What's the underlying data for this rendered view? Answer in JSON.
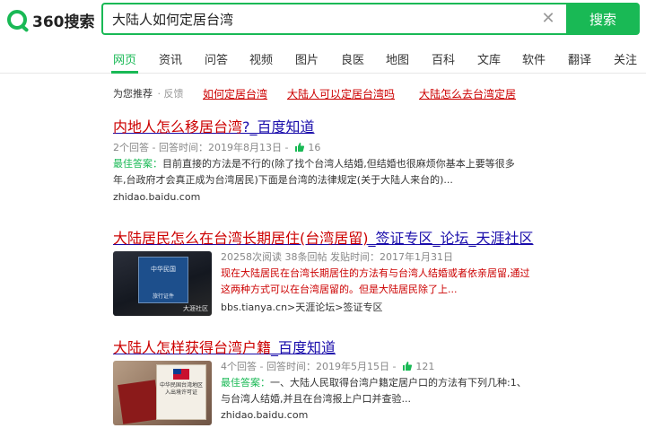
{
  "header": {
    "logo_text": "360搜索",
    "search_value": "大陆人如何定居台湾",
    "search_button": "搜索"
  },
  "tabs": [
    "网页",
    "资讯",
    "问答",
    "视频",
    "图片",
    "良医",
    "地图",
    "百科",
    "文库",
    "软件",
    "翻译",
    "关注"
  ],
  "recommend": {
    "label": "为您推荐",
    "feedback": "· 反馈",
    "links": [
      "如何定居台湾",
      "大陆人可以定居台湾吗",
      "大陆怎么去台湾定居"
    ]
  },
  "results": [
    {
      "title_pre": "",
      "title_hl": "内地人怎么移居台湾",
      "title_post": "?_百度知道",
      "meta": "2个回答 - 回答时间：2019年8月13日 - ",
      "likes": "16",
      "best_label": "最佳答案：",
      "snippet_1": "目前直接的方法是不行的(除了找个台湾人结婚,但结婚也很麻烦你基本上要等很多",
      "snippet_2": "年,台政府才会真正成为台湾居民)下面是台湾的法律规定(关于大陆人来台的)...",
      "url": "zhidao.baidu.com"
    },
    {
      "title_hl": "大陆居民怎么在台湾长期居住(台湾居留)",
      "title_post": "_签证专区_论坛_天涯社区",
      "meta": "20258次阅读  38条回帖  发贴时间：2017年1月31日",
      "snippet_1": "现在大陆居民在台湾长期居住的方法有与台湾人结婚或者依亲居留,通过",
      "snippet_2": "这两种方式可以在台湾居留的。但是大陆居民除了上...",
      "url": "bbs.tianya.cn>天涯论坛>签证专区",
      "thumb_text_1": "中华民国",
      "thumb_text_2": "旅行证件",
      "thumb_watermark": "大涯社区"
    },
    {
      "title_hl": "大陆人怎样获得台湾户籍",
      "title_post": "_百度知道",
      "meta": "4个回答 - 回答时间：2019年5月15日 - ",
      "likes": "121",
      "best_label": "最佳答案：",
      "snippet_1": "一、大陆人民取得台湾户籍定居户口的方法有下列几种:1、",
      "snippet_2": "与台湾人结婚,并且在台湾报上户口并查验...",
      "url": "zhidao.baidu.com",
      "thumb_text": "中华民国台湾地区入出境许可证"
    }
  ],
  "colors": {
    "accent": "#19b955",
    "link": "#1a0dab",
    "highlight": "#cc0000"
  }
}
